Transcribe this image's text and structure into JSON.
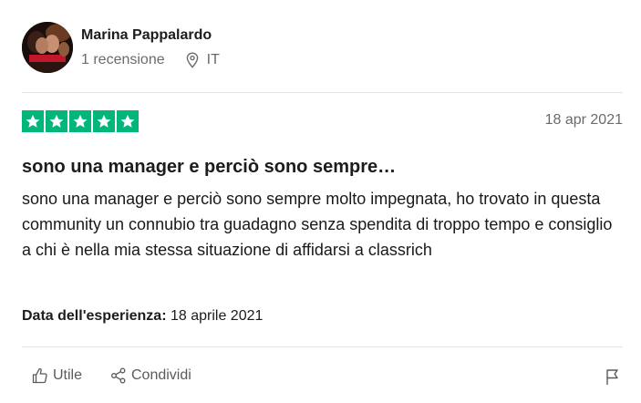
{
  "reviewer": {
    "name": "Marina Pappalardo",
    "review_count": "1 recensione",
    "country": "IT"
  },
  "review": {
    "rating": 5,
    "rating_max": 5,
    "date": "18 apr 2021",
    "title": "sono una manager e perciò sono sempre…",
    "body": "sono una manager e perciò sono sempre molto impegnata, ho trovato in questa community un connubio tra guadagno senza spendita di troppo tempo e consiglio a chi è nella mia stessa situazione di affidarsi a classrich",
    "experience_label": "Data dell'esperienza:",
    "experience_date": "18 aprile 2021"
  },
  "actions": {
    "like_label": "Utile",
    "share_label": "Condividi"
  },
  "colors": {
    "star_green": "#00b67a",
    "muted_text": "#6b6b6b"
  }
}
